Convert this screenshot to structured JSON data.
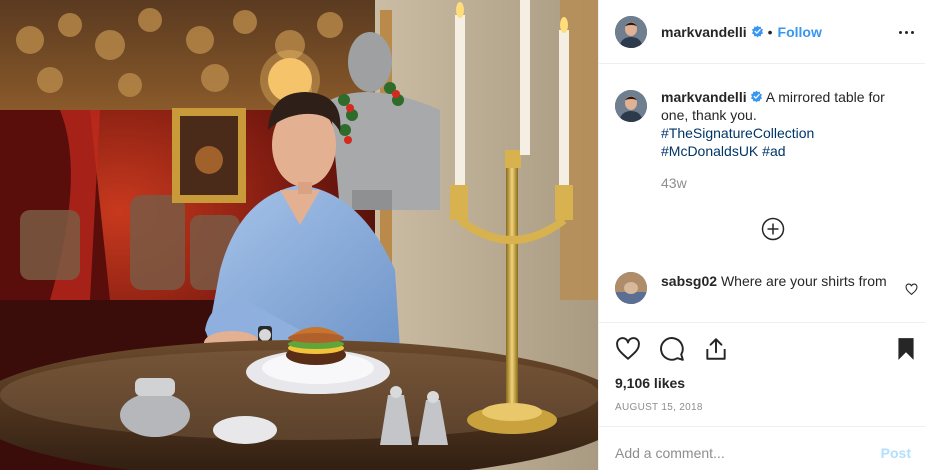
{
  "post": {
    "author": "markvandelli",
    "verified": true,
    "follow_label": "Follow",
    "separator": "•",
    "caption_text": "A mirrored table for one, thank you.",
    "hashtags": [
      "#TheSignatureCollection",
      "#McDonaldsUK"
    ],
    "hashtag_inline": "#ad",
    "age": "43w",
    "likes": "9,106 likes",
    "date": "August 15, 2018"
  },
  "comments": [
    {
      "author": "sabsg02",
      "text": "Where are your shirts from"
    }
  ],
  "composer": {
    "placeholder": "Add a comment...",
    "post_label": "Post"
  },
  "icons": {
    "more": "more-options-icon",
    "verified": "verified-badge-icon",
    "load_more": "load-more-comments-icon",
    "like": "heart-icon",
    "comment": "comment-icon",
    "share": "share-icon",
    "save": "bookmark-icon"
  },
  "colors": {
    "link_blue": "#3897f0",
    "hashtag": "#003569",
    "muted": "#8e8e8e",
    "post_disabled": "#b2dffc"
  }
}
